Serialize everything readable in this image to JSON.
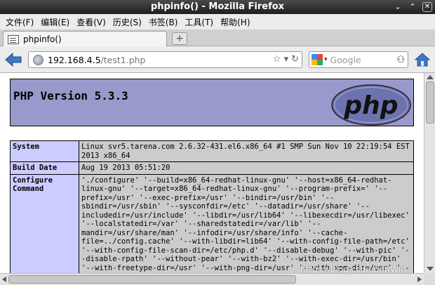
{
  "window": {
    "title": "phpinfo() - Mozilla Firefox",
    "minimize_glyph": "⌄",
    "maximize_glyph": "⌃",
    "close_glyph": "✕"
  },
  "menu": [
    "文件(F)",
    "编辑(E)",
    "查看(V)",
    "历史(S)",
    "书签(B)",
    "工具(T)",
    "帮助(H)"
  ],
  "tab": {
    "label": "phpinfo()",
    "new_tab_glyph": "+"
  },
  "nav": {
    "url_host": "192.168.4.5",
    "url_path": "/test1.php",
    "star_glyph": "☆",
    "dropdown_glyph": "▾",
    "reload_glyph": "↻",
    "search_placeholder": "Google",
    "search_dropdown_glyph": "▾",
    "binoculars_glyph": "⚇"
  },
  "page": {
    "version": "PHP Version 5.3.3",
    "logo_text": "php",
    "rows": [
      {
        "key": "System",
        "value": "Linux svr5.tarena.com 2.6.32-431.el6.x86_64 #1 SMP Sun Nov 10 22:19:54 EST 2013 x86_64"
      },
      {
        "key": "Build Date",
        "value": "Aug 19 2013 05:51:20"
      },
      {
        "key": "Configure Command",
        "value": "'./configure' '--build=x86_64-redhat-linux-gnu' '--host=x86_64-redhat-linux-gnu' '--target=x86_64-redhat-linux-gnu' '--program-prefix=' '--prefix=/usr' '--exec-prefix=/usr' '--bindir=/usr/bin' '--sbindir=/usr/sbin' '--sysconfdir=/etc' '--datadir=/usr/share' '--includedir=/usr/include' '--libdir=/usr/lib64' '--libexecdir=/usr/libexec' '--localstatedir=/var' '--sharedstatedir=/var/lib' '--mandir=/usr/share/man' '--infodir=/usr/share/info' '--cache-file=../config.cache' '--with-libdir=lib64' '--with-config-file-path=/etc' '--with-config-file-scan-dir=/etc/php.d' '--disable-debug' '--with-pic' '--disable-rpath' '--without-pear' '--with-bz2' '--with-exec-dir=/usr/bin' '--with-freetype-dir=/usr' '--with-png-dir=/usr' '--with-xpm-dir=/usr' '--enable-gd-native-ttf' '--without-gdbm' '--with-gettext'"
      }
    ]
  },
  "watermark": "https://blog.csdn.net/Win_"
}
